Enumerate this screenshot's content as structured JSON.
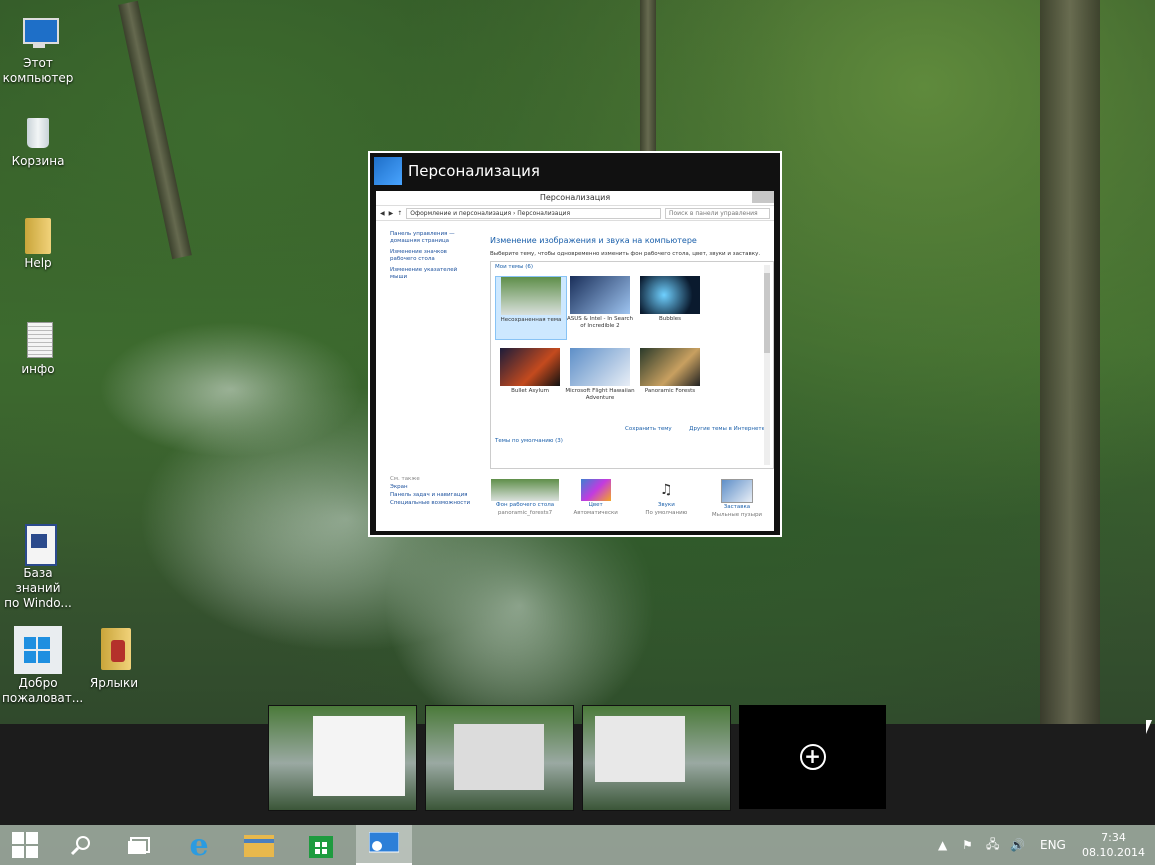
{
  "desktop": {
    "icons": [
      {
        "label": "Этот\nкомпьютер"
      },
      {
        "label": "Корзина"
      },
      {
        "label": "Help"
      },
      {
        "label": "инфо"
      },
      {
        "label": "База знаний\nпо Windo..."
      },
      {
        "label": "Добро\nпожаловат..."
      },
      {
        "label": "Ярлыки"
      }
    ]
  },
  "preview": {
    "title": "Персонализация",
    "window": {
      "title": "Персонализация",
      "breadcrumb": "Оформление и персонализация  ›  Персонализация",
      "search_placeholder": "Поиск в панели управления",
      "left_links": [
        "Панель управления — домашняя страница",
        "Изменение значков рабочего стола",
        "Изменение указателей мыши"
      ],
      "see_also": {
        "heading": "См. также",
        "items": [
          "Экран",
          "Панель задач и навигация",
          "Специальные возможности"
        ]
      },
      "heading": "Изменение изображения и звука на компьютере",
      "subheading": "Выберите тему, чтобы одновременно изменить фон рабочего стола, цвет, звуки и заставку.",
      "my_themes_label": "Мои темы (6)",
      "themes": [
        {
          "name": "Несохраненная тема"
        },
        {
          "name": "ASUS & Intel - In Search of Incredible 2"
        },
        {
          "name": "Bubbles"
        },
        {
          "name": "Bullet Asylum"
        },
        {
          "name": "Microsoft Flight Hawaiian Adventure"
        },
        {
          "name": "Panoramic Forests"
        }
      ],
      "save_theme": "Сохранить тему",
      "more_themes": "Другие темы в Интернете",
      "default_themes_label": "Темы по умолчанию (3)",
      "bottom": [
        {
          "title": "Фон рабочего стола",
          "sub": "panoramic_forests7"
        },
        {
          "title": "Цвет",
          "sub": "Автоматически"
        },
        {
          "title": "Звуки",
          "sub": "По умолчанию"
        },
        {
          "title": "Заставка",
          "sub": "Мыльные пузыри"
        }
      ]
    }
  },
  "taskview": {
    "add_desktop_symbol": "+"
  },
  "tray": {
    "language": "ENG",
    "time": "7:34",
    "date": "08.10.2014"
  },
  "colors": {
    "accent": "#1a5faa",
    "strip": "#1c1c1c"
  }
}
